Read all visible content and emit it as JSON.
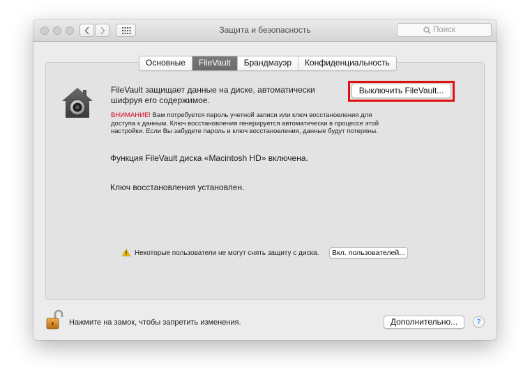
{
  "window": {
    "title": "Защита и безопасность",
    "search_placeholder": "Поиск"
  },
  "tabs": [
    {
      "label": "Основные"
    },
    {
      "label": "FileVault",
      "active": true
    },
    {
      "label": "Брандмауэр"
    },
    {
      "label": "Конфиденциальность"
    }
  ],
  "filevault": {
    "description": "FileVault защищает данные на диске, автоматически шифруя его содержимое.",
    "turn_off_label": "Выключить FileVault...",
    "warning_prefix": "ВНИМАНИЕ!",
    "warning_text": " Вам потребуется пароль учетной записи или ключ восстановления для доступа к данным. Ключ восстановления генерируется автоматически в процессе этой настройки. Если Вы забудете пароль и ключ восстановления, данные будут потеряны.",
    "status_enabled": "Функция FileVault диска «Macintosh HD» включена.",
    "status_key": "Ключ восстановления установлен.",
    "users_warning": "Некоторые пользователи не могут снять защиту с диска.",
    "enable_users_label": "Вкл. пользователей..."
  },
  "footer": {
    "lock_text": "Нажмите на замок, чтобы запретить изменения.",
    "advanced_label": "Дополнительно...",
    "help_label": "?"
  },
  "colors": {
    "warning_red": "#d0021b",
    "highlight_red": "#e01010",
    "active_tab": "#6e6e6e"
  },
  "icons": [
    "back-icon",
    "forward-icon",
    "grid-icon",
    "magnifier-icon",
    "filevault-house-icon",
    "warning-icon",
    "unlocked-lock-icon",
    "help-icon"
  ]
}
